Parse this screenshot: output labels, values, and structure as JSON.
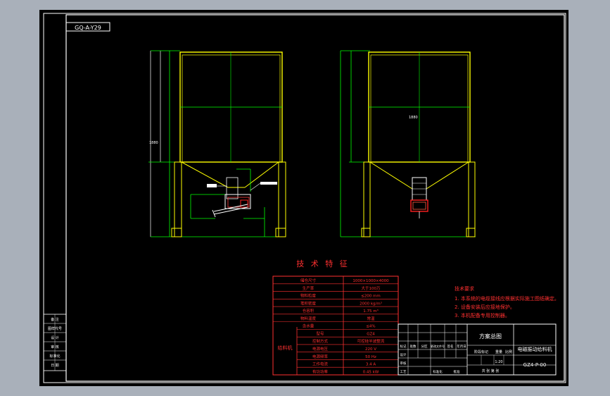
{
  "drawing": {
    "code_box": "GQ-A-Y29",
    "code_box_rot": "GQ-A-Y29",
    "drawing_number": "GZ4-P-00",
    "drawing_title": "电磁振动给料机",
    "scheme": "方案总图",
    "scale": "1:20",
    "dims": {
      "left_height": "1880",
      "right_height": "1880"
    }
  },
  "tech": {
    "title": "技 术 特 征",
    "rows": [
      {
        "label": "储仓尺寸",
        "value": "1000×1000×4000"
      },
      {
        "label": "生产率",
        "value": "大于100万"
      },
      {
        "label": "物料粒度",
        "value": "≤200 mm"
      },
      {
        "label": "堆积密度",
        "value": "2000 kg/m³"
      },
      {
        "label": "仓容积",
        "value": "1.75 m³"
      },
      {
        "label": "物料温度",
        "value": "常温"
      },
      {
        "label": "含水量",
        "value": "≤4%"
      },
      {
        "label": "型号",
        "value": "GZ4"
      },
      {
        "label": "控制方式",
        "value": "可控硅半波整流"
      },
      {
        "label": "电源电压",
        "value": "220 V"
      },
      {
        "label": "电源频率",
        "value": "50 Hz"
      },
      {
        "label": "工作电流",
        "value": "3.4 A"
      },
      {
        "label": "有功功率",
        "value": "0.45 kW"
      }
    ],
    "group_label": "给料机"
  },
  "notes": {
    "title": "技术要求",
    "items": [
      "1. 本系统的电缆接线应根据实际施工图纸确定。",
      "2. 设备安装后应接地保护。",
      "3. 本机配备专用控制器。"
    ]
  },
  "left_table": {
    "rows": [
      "备  注",
      "图样代号",
      "设  计",
      "审  核",
      "标准化",
      "日  期"
    ]
  },
  "title_block": {
    "headers": [
      "标记",
      "处数",
      "分区",
      "更改文件号",
      "签名",
      "年月日"
    ],
    "col_labels": [
      "阶段标记",
      "重量",
      "比例"
    ],
    "bottom_labels": [
      "共 张 第 张"
    ],
    "row_labels": [
      "设计",
      "审核",
      "工艺",
      "标准化",
      "批准"
    ]
  }
}
